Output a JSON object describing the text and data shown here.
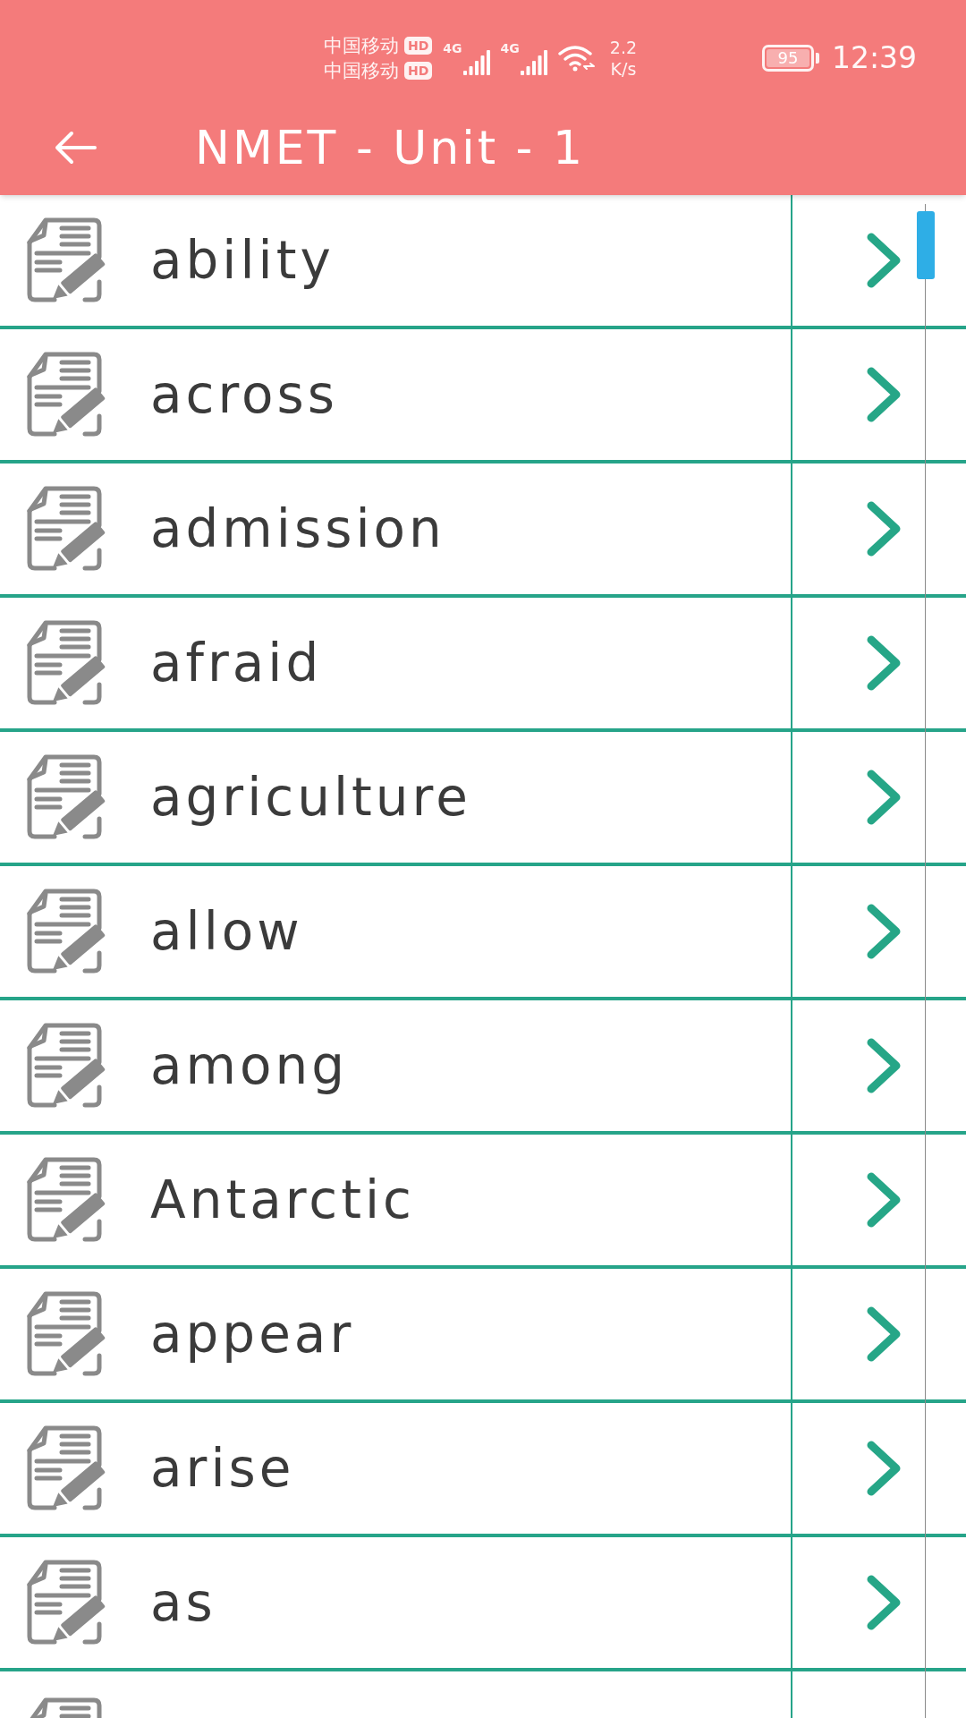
{
  "status_bar": {
    "carriers": [
      {
        "name": "中国移动",
        "badge": "HD"
      },
      {
        "name": "中国移动",
        "badge": "HD"
      }
    ],
    "networks": [
      {
        "type": "4G"
      },
      {
        "type": "4G"
      }
    ],
    "speed": {
      "value": "2.2",
      "unit": "K/s"
    },
    "battery": "95",
    "time": "12:39"
  },
  "header": {
    "title": "NMET - Unit - 1"
  },
  "list": {
    "rows": [
      {
        "word": "ability"
      },
      {
        "word": "across"
      },
      {
        "word": "admission"
      },
      {
        "word": "afraid"
      },
      {
        "word": "agriculture"
      },
      {
        "word": "allow"
      },
      {
        "word": "among"
      },
      {
        "word": "Antarctic"
      },
      {
        "word": "appear"
      },
      {
        "word": "arise"
      },
      {
        "word": "as"
      }
    ],
    "more_below": true
  }
}
